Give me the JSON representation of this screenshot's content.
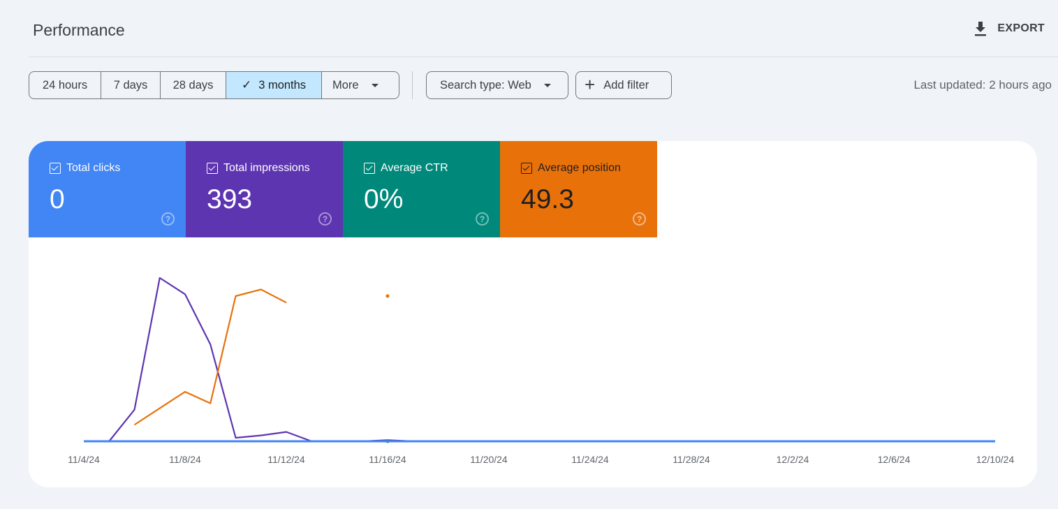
{
  "header": {
    "title": "Performance",
    "export_label": "EXPORT",
    "export_icon": "download-icon"
  },
  "filters": {
    "date_ranges": [
      {
        "label": "24 hours",
        "selected": false
      },
      {
        "label": "7 days",
        "selected": false
      },
      {
        "label": "28 days",
        "selected": false
      },
      {
        "label": "3 months",
        "selected": true
      },
      {
        "label": "More",
        "selected": false
      }
    ],
    "search_type": "Search type: Web",
    "add_filter": "Add filter",
    "last_updated": "Last updated: 2 hours ago"
  },
  "metrics": [
    {
      "key": "clicks",
      "label": "Total clicks",
      "value": "0",
      "checked": true,
      "color": "#4285f4"
    },
    {
      "key": "impressions",
      "label": "Total impressions",
      "value": "393",
      "checked": true,
      "color": "#5e35b1"
    },
    {
      "key": "ctr",
      "label": "Average CTR",
      "value": "0%",
      "checked": true,
      "color": "#00897b"
    },
    {
      "key": "position",
      "label": "Average position",
      "value": "49.3",
      "checked": true,
      "color": "#e8710a"
    }
  ],
  "chart_data": {
    "type": "line",
    "title": "",
    "xlabel": "",
    "ylabel": "",
    "grid": false,
    "legend": "metric cards (top-left)",
    "x": [
      "11/4/24",
      "11/5/24",
      "11/6/24",
      "11/7/24",
      "11/8/24",
      "11/9/24",
      "11/10/24",
      "11/11/24",
      "11/12/24",
      "11/13/24",
      "11/14/24",
      "11/15/24",
      "11/16/24",
      "11/17/24",
      "11/18/24",
      "11/19/24",
      "11/20/24",
      "11/21/24",
      "11/22/24",
      "11/23/24",
      "11/24/24",
      "11/25/24",
      "11/26/24",
      "11/27/24",
      "11/28/24",
      "11/29/24",
      "11/30/24",
      "12/1/24",
      "12/2/24",
      "12/3/24",
      "12/4/24",
      "12/5/24",
      "12/6/24",
      "12/7/24",
      "12/8/24",
      "12/9/24",
      "12/10/24"
    ],
    "x_tick_labels": [
      "11/4/24",
      "11/8/24",
      "11/12/24",
      "11/16/24",
      "11/20/24",
      "11/24/24",
      "11/28/24",
      "12/2/24",
      "12/6/24",
      "12/10/24"
    ],
    "series": [
      {
        "name": "Total clicks",
        "color": "#4285f4",
        "ylim": [
          0,
          1
        ],
        "values": [
          0,
          0,
          0,
          0,
          0,
          0,
          0,
          0,
          0,
          0,
          0,
          0,
          0,
          0,
          0,
          0,
          0,
          0,
          0,
          0,
          0,
          0,
          0,
          0,
          0,
          0,
          0,
          0,
          0,
          0,
          0,
          0,
          0,
          0,
          0,
          0,
          0
        ]
      },
      {
        "name": "Average CTR",
        "color": "#00897b",
        "ylim": [
          0,
          1
        ],
        "values": [
          null,
          null,
          0,
          0,
          0,
          0,
          0,
          0,
          0,
          null,
          null,
          null,
          0,
          null,
          null,
          null,
          null,
          null,
          null,
          null,
          null,
          null,
          null,
          null,
          null,
          null,
          null,
          null,
          null,
          null,
          null,
          null,
          null,
          null,
          null,
          null,
          null
        ]
      },
      {
        "name": "Total impressions",
        "color": "#5e35b1",
        "ylim": [
          0,
          140
        ],
        "values": [
          0,
          0,
          27,
          140,
          126,
          83,
          3,
          5,
          8,
          0,
          0,
          0,
          1,
          0,
          0,
          0,
          0,
          0,
          0,
          0,
          0,
          0,
          0,
          0,
          0,
          0,
          0,
          0,
          0,
          0,
          0,
          0,
          0,
          0,
          0,
          0,
          0
        ]
      },
      {
        "name": "Average position",
        "color": "#e8710a",
        "ylim": [
          100,
          1
        ],
        "inverted": true,
        "values": [
          null,
          null,
          90,
          80,
          70,
          77,
          12,
          8,
          16,
          null,
          null,
          null,
          12,
          null,
          null,
          null,
          null,
          null,
          null,
          null,
          null,
          null,
          null,
          null,
          null,
          null,
          null,
          null,
          null,
          null,
          null,
          null,
          null,
          null,
          null,
          null,
          null
        ]
      }
    ]
  }
}
